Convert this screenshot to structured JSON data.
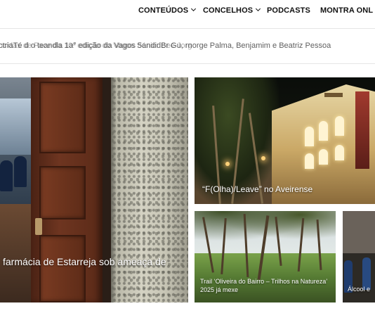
{
  "nav": {
    "items": [
      {
        "label": "CONTEÚDOS",
        "has_dropdown": true,
        "icon": "chevron-down-icon"
      },
      {
        "label": "CONCELHOS",
        "has_dropdown": true,
        "icon": "chevron-down-icon"
      },
      {
        "label": "PODCASTS",
        "has_dropdown": false
      },
      {
        "label": "MONTRA ONL",
        "has_dropdown": false
      }
    ]
  },
  "ticker": {
    "text_front": "ctriaTé d o teandla 1a° edição da Vagos 5andidBr Gu, rnorge Palma, Benjamim e Beatriz Pessoa",
    "text_back": "ncidas de Face da 10ª edição do Vagos Sénior Bee Jorg"
  },
  "cards": {
    "main": {
      "title": "farmácia de Estarreja sob ameaça de"
    },
    "theatre": {
      "title": "“F(Olha)/Leave” no Aveirense"
    },
    "trail": {
      "title": "Trail ‘Oliveira do Bairro – Trilhos na Natureza’ 2025 já mexe"
    },
    "alcool": {
      "title": "Álcool e"
    }
  },
  "colors": {
    "text_dark": "#111111",
    "card_overlay_text": "#ffffff",
    "divider": "#e6e6e6"
  }
}
